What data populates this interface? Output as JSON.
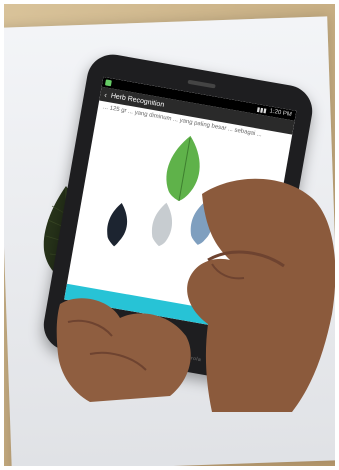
{
  "phone": {
    "status_time": "1:20 PM",
    "app_title": "Herb Recognition",
    "description": "... 125 gr ... yang diminum ... yang paling besar ... sebagai ...",
    "brand": "motorola"
  },
  "colors": {
    "accent_bar": "#27c3d6",
    "leaf_dark": "#2e3a1c",
    "leaf_green": "#5fb24a",
    "leaf_grey": "#c7ccd0",
    "leaf_blue": "#7f9fbf"
  }
}
